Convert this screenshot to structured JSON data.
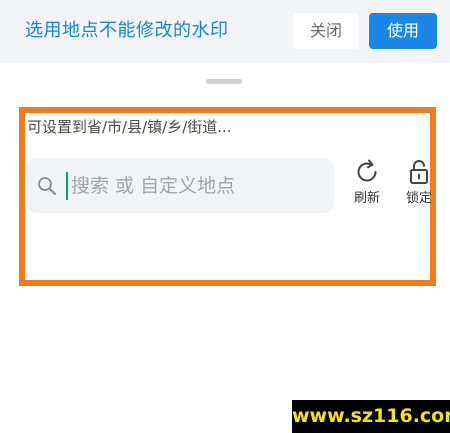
{
  "header": {
    "title": "选用地点不能修改的水印",
    "close_label": "关闭",
    "use_label": "使用"
  },
  "location": {
    "hint": "可设置到省/市/县/镇/乡/街道...",
    "search_placeholder": "搜索 或 自定义地点",
    "search_icon": "search-icon"
  },
  "tools": {
    "refresh": {
      "label": "刷新",
      "icon": "refresh-icon"
    },
    "lock": {
      "label": "锁定",
      "icon": "unlock-icon"
    }
  },
  "watermark": {
    "text": "www.sz116.com"
  },
  "colors": {
    "accent": "#1a86e6",
    "title": "#1c83db",
    "highlight": "#f47a1f",
    "cursor": "#12a06d",
    "watermark_text": "#f5e600"
  }
}
